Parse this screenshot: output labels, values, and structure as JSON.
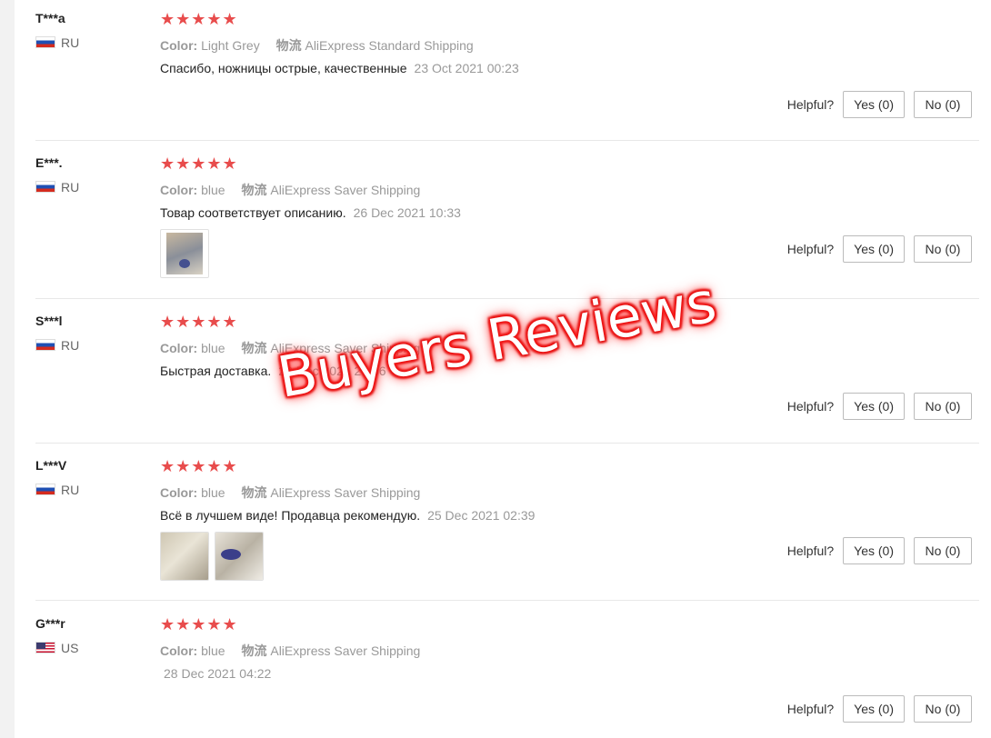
{
  "labels": {
    "helpful": "Helpful?",
    "color_key": "Color:",
    "shipping_key": "物流"
  },
  "reviews": [
    {
      "user": "T***a",
      "country": "RU",
      "stars": "★★★★★",
      "color": "Light Grey",
      "shipping": "AliExpress Standard Shipping",
      "text": "Спасибо, ножницы острые, качественные",
      "date": "23 Oct 2021 00:23",
      "yes": "Yes (0)",
      "no": "No (0)"
    },
    {
      "user": "E***.",
      "country": "RU",
      "stars": "★★★★★",
      "color": "blue",
      "shipping": "AliExpress Saver Shipping",
      "text": "Товар соответствует описанию.",
      "date": "26 Dec 2021 10:33",
      "yes": "Yes (0)",
      "no": "No (0)"
    },
    {
      "user": "S***l",
      "country": "RU",
      "stars": "★★★★★",
      "color": "blue",
      "shipping": "AliExpress Saver Shipping",
      "text": "Быстрая доставка.",
      "date": "28 Dec 2021 20:36",
      "yes": "Yes (0)",
      "no": "No (0)"
    },
    {
      "user": "L***V",
      "country": "RU",
      "stars": "★★★★★",
      "color": "blue",
      "shipping": "AliExpress Saver Shipping",
      "text": "Всё в лучшем виде! Продавца рекомендую.",
      "date": "25 Dec 2021 02:39",
      "yes": "Yes (0)",
      "no": "No (0)"
    },
    {
      "user": "G***r",
      "country": "US",
      "stars": "★★★★★",
      "color": "blue",
      "shipping": "AliExpress Saver Shipping",
      "text": "",
      "date": "28 Dec 2021 04:22",
      "yes": "Yes (0)",
      "no": "No (0)"
    }
  ],
  "watermark": "Buyers Reviews",
  "colors": {
    "star": "#e84c4c",
    "watermark_glow": "#ff1a1a",
    "divider": "#e8e8e8"
  }
}
